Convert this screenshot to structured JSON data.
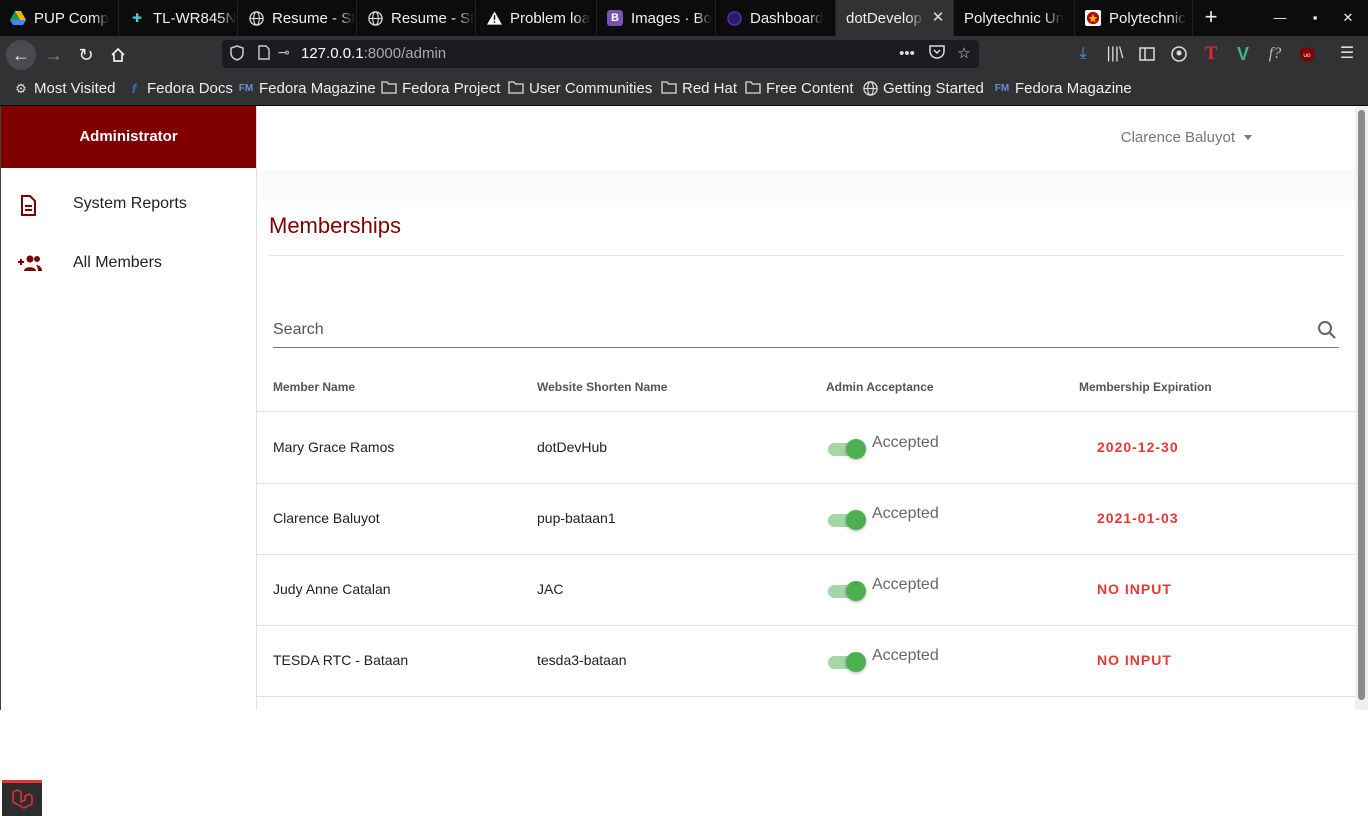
{
  "browser": {
    "tabs": [
      {
        "title": "PUP Comp",
        "icon": "google-drive-icon",
        "color": "#f4b400"
      },
      {
        "title": "TL-WR845N",
        "icon": "tp-link-icon",
        "color": "#4acbd6"
      },
      {
        "title": "Resume - St",
        "icon": "globe-icon",
        "color": "#ddd"
      },
      {
        "title": "Resume - St",
        "icon": "globe-icon",
        "color": "#ddd"
      },
      {
        "title": "Problem loa",
        "icon": "warning-icon",
        "color": "#fff"
      },
      {
        "title": "Images · Bo",
        "icon": "bootstrap-icon",
        "color": "#7952b3"
      },
      {
        "title": "Dashboard",
        "icon": "dashboard-icon",
        "color": "#5b2fbf"
      },
      {
        "title": "dotDevelop",
        "icon": "none",
        "color": "#fff"
      },
      {
        "title": "Polytechnic Un",
        "icon": "none",
        "color": "#fff"
      },
      {
        "title": "Polytechnic",
        "icon": "pup-icon",
        "color": "#b00"
      }
    ],
    "new_tab": "+",
    "url_host": "127.0.0.1",
    "url_rest": ":8000/admin",
    "bookmarks": [
      {
        "label": "Most Visited",
        "icon": "gear-icon"
      },
      {
        "label": "Fedora Docs",
        "icon": "fedora-icon"
      },
      {
        "label": "Fedora Magazine",
        "icon": "fedora-magazine-icon"
      },
      {
        "label": "Fedora Project",
        "icon": "folder-icon"
      },
      {
        "label": "User Communities",
        "icon": "folder-icon"
      },
      {
        "label": "Red Hat",
        "icon": "folder-icon"
      },
      {
        "label": "Free Content",
        "icon": "folder-icon"
      },
      {
        "label": "Getting Started",
        "icon": "globe-icon"
      },
      {
        "label": "Fedora Magazine",
        "icon": "fedora-magazine-icon"
      }
    ]
  },
  "sidebar": {
    "header": "Administrator",
    "items": [
      {
        "label": "System Reports",
        "icon": "document-icon"
      },
      {
        "label": "All Members",
        "icon": "add-group-icon"
      }
    ]
  },
  "topbar": {
    "user": "Clarence Baluyot"
  },
  "main": {
    "title": "Memberships",
    "search_placeholder": "Search",
    "columns": [
      "Member Name",
      "Website Shorten Name",
      "Admin Acceptance",
      "Membership Expiration"
    ],
    "rows": [
      {
        "name": "Mary Grace Ramos",
        "website": "dotDevHub",
        "status": "Accepted",
        "expiration": "2020-12-30"
      },
      {
        "name": "Clarence Baluyot",
        "website": "pup-bataan1",
        "status": "Accepted",
        "expiration": "2021-01-03"
      },
      {
        "name": "Judy Anne Catalan",
        "website": "JAC",
        "status": "Accepted",
        "expiration": "NO INPUT"
      },
      {
        "name": "TESDA RTC - Bataan",
        "website": "tesda3-bataan",
        "status": "Accepted",
        "expiration": "NO INPUT"
      }
    ]
  },
  "colors": {
    "brand": "#800000",
    "accept": "#4caf50",
    "expiration": "#e53935"
  }
}
